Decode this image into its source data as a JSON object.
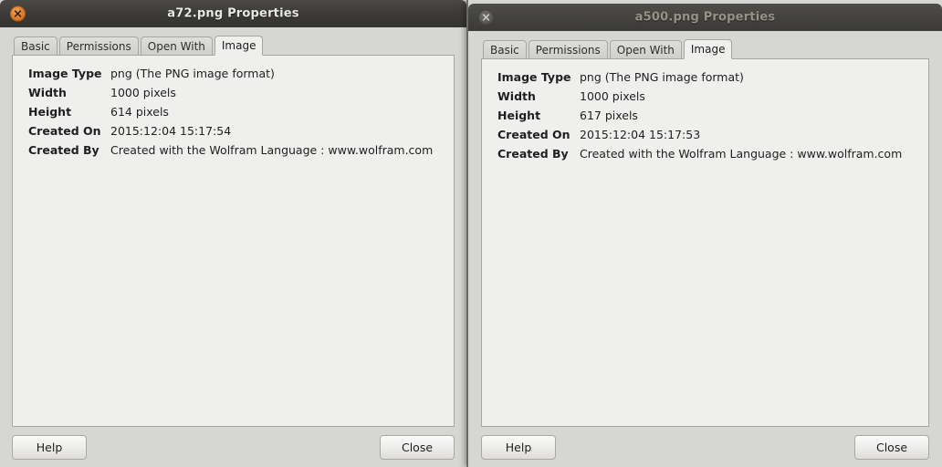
{
  "desktop": {
    "background_color": "#b8b8b4",
    "accent_sliver_color": "#9c5a22"
  },
  "windows": [
    {
      "id": "left",
      "title": "a72.png Properties",
      "state": "active",
      "close_icon": "close-icon",
      "close_button_color": "#df7e28",
      "tabs": [
        {
          "label": "Basic",
          "active": false
        },
        {
          "label": "Permissions",
          "active": false
        },
        {
          "label": "Open With",
          "active": false
        },
        {
          "label": "Image",
          "active": true
        }
      ],
      "properties": [
        {
          "label": "Image Type",
          "value": "png (The PNG image format)"
        },
        {
          "label": "Width",
          "value": "1000 pixels"
        },
        {
          "label": "Height",
          "value": "614 pixels"
        },
        {
          "label": "Created On",
          "value": "2015:12:04 15:17:54"
        },
        {
          "label": "Created By",
          "value": "Created with the Wolfram Language : www.wolfram.com"
        }
      ],
      "buttons": {
        "help_label": "Help",
        "close_label": "Close"
      }
    },
    {
      "id": "right",
      "title": "a500.png Properties",
      "state": "inactive",
      "close_icon": "close-icon",
      "close_button_color": "#5a5955",
      "tabs": [
        {
          "label": "Basic",
          "active": false
        },
        {
          "label": "Permissions",
          "active": false
        },
        {
          "label": "Open With",
          "active": false
        },
        {
          "label": "Image",
          "active": true
        }
      ],
      "properties": [
        {
          "label": "Image Type",
          "value": "png (The PNG image format)"
        },
        {
          "label": "Width",
          "value": "1000 pixels"
        },
        {
          "label": "Height",
          "value": "617 pixels"
        },
        {
          "label": "Created On",
          "value": "2015:12:04 15:17:53"
        },
        {
          "label": "Created By",
          "value": "Created with the Wolfram Language : www.wolfram.com"
        }
      ],
      "buttons": {
        "help_label": "Help",
        "close_label": "Close"
      }
    }
  ]
}
